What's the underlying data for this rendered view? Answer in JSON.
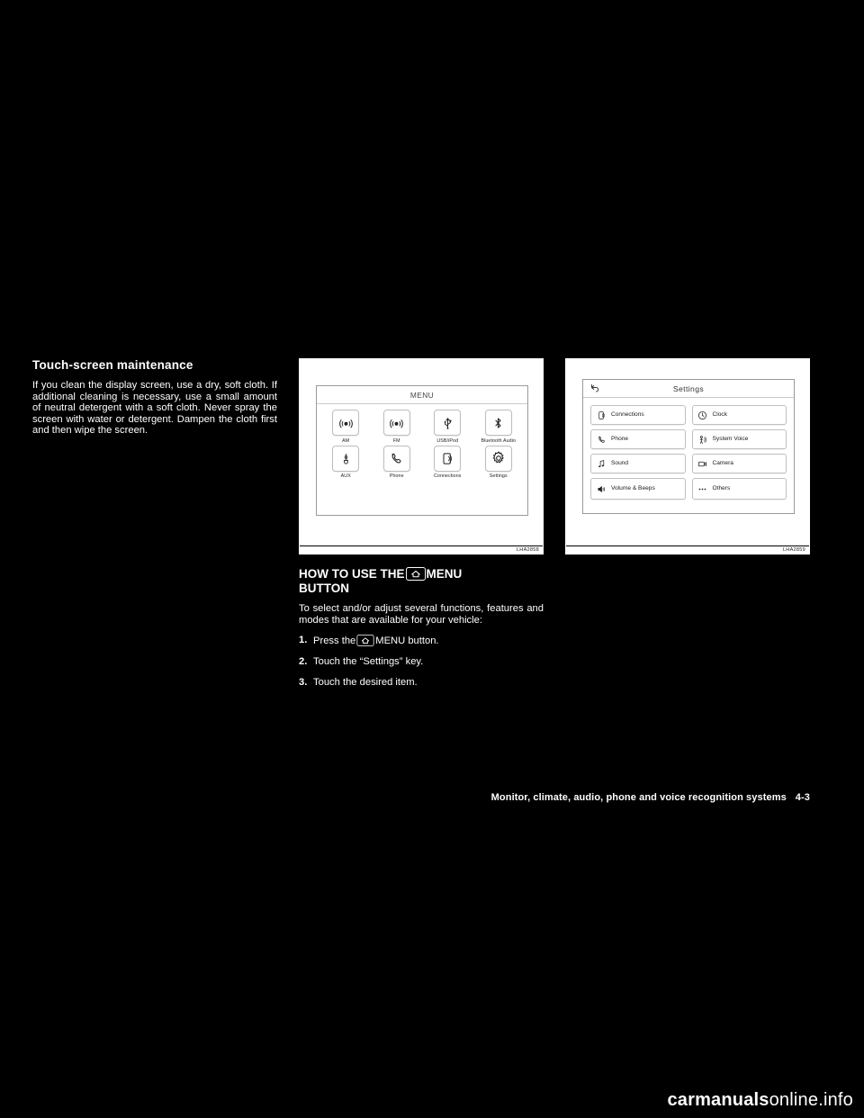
{
  "left": {
    "heading": "Touch-screen maintenance",
    "body": "If you clean the display screen, use a dry, soft cloth. If additional cleaning is necessary, use a small amount of neutral detergent with a soft cloth. Never spray the screen with water or detergent. Dampen the cloth first and then wipe the screen."
  },
  "figure_menu": {
    "title": "MENU",
    "caption": "LHA2858",
    "items": [
      {
        "label": "AM",
        "icon": "am-radio-icon"
      },
      {
        "label": "FM",
        "icon": "fm-radio-icon"
      },
      {
        "label": "USB/iPod",
        "icon": "usb-icon"
      },
      {
        "label": "Bluetooth Audio",
        "icon": "bluetooth-icon"
      },
      {
        "label": "AUX",
        "icon": "aux-icon"
      },
      {
        "label": "Phone",
        "icon": "phone-icon"
      },
      {
        "label": "Connections",
        "icon": "connections-icon"
      },
      {
        "label": "Settings",
        "icon": "gear-icon"
      }
    ]
  },
  "figure_settings": {
    "title": "Settings",
    "caption": "LHA2859",
    "back_icon": "back-arrow-icon",
    "items_left": [
      {
        "label": "Connections",
        "icon": "connections-icon"
      },
      {
        "label": "Phone",
        "icon": "phone-icon"
      },
      {
        "label": "Sound",
        "icon": "music-note-icon"
      },
      {
        "label": "Volume & Beeps",
        "icon": "speaker-icon"
      }
    ],
    "items_right": [
      {
        "label": "Clock",
        "icon": "clock-icon"
      },
      {
        "label": "System Voice",
        "icon": "person-voice-icon"
      },
      {
        "label": "Camera",
        "icon": "camera-icon"
      },
      {
        "label": "Others",
        "icon": "ellipsis-icon"
      }
    ]
  },
  "middle": {
    "heading_part1": "HOW TO USE THE",
    "heading_part2": "MENU",
    "heading_part3": "BUTTON",
    "intro": "To select and/or adjust several functions, features and modes that are available for your vehicle:",
    "steps": [
      {
        "num": "1.",
        "text_before": "Press the",
        "text_after": "MENU button."
      },
      {
        "num": "2.",
        "text": "Touch the “Settings” key."
      },
      {
        "num": "3.",
        "text": "Touch the desired item."
      }
    ]
  },
  "footer": {
    "text": "Monitor, climate, audio, phone and voice recognition systems",
    "page": "4-3"
  },
  "watermark": {
    "bold": "carmanuals",
    "light": "online.info"
  }
}
